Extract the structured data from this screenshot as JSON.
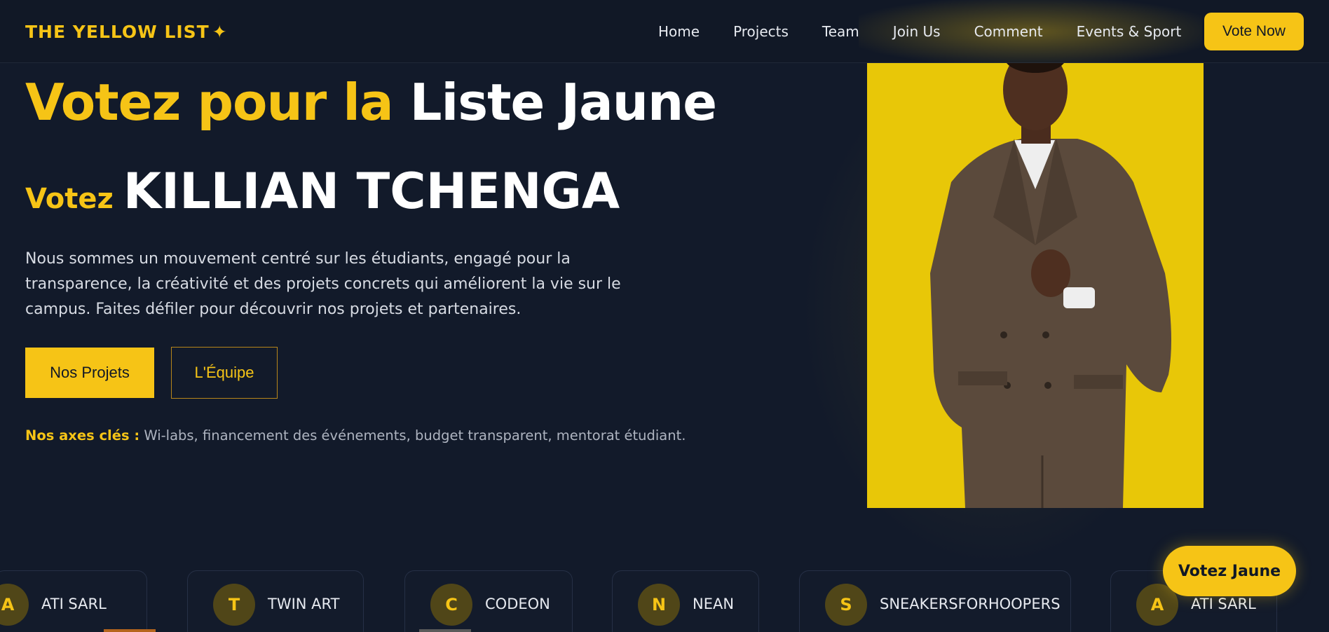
{
  "brand": {
    "name": "THE YELLOW LIST",
    "spark": "✦"
  },
  "nav": {
    "links": [
      "Home",
      "Projects",
      "Team",
      "Join Us",
      "Comment",
      "Events & Sport"
    ],
    "cta": "Vote Now"
  },
  "hero": {
    "title_part1": "Votez pour la",
    "title_part2": "Liste Jaune",
    "subtitle_prefix": "Votez",
    "subtitle_name": "KILLIAN TCHENGA",
    "description": "Nous sommes un mouvement centré sur les étudiants, engagé pour la transparence, la créativité et des projets concrets qui améliorent la vie sur le campus. Faites défiler pour découvrir nos projets et partenaires.",
    "primary_button": "Nos Projets",
    "secondary_button": "L'Équipe",
    "axes_label": "Nos axes clés :",
    "axes_text": "Wi-labs, financement des événements, budget transparent, mentorat étudiant."
  },
  "floating_button": "Votez Jaune",
  "partners": [
    {
      "initial": "A",
      "name": "ATI SARL"
    },
    {
      "initial": "T",
      "name": "TWIN ART"
    },
    {
      "initial": "C",
      "name": "CODEON"
    },
    {
      "initial": "N",
      "name": "NEAN"
    },
    {
      "initial": "S",
      "name": "SNEAKERSFORHOOPERS"
    },
    {
      "initial": "A",
      "name": "ATI SARL"
    }
  ],
  "colors": {
    "accent": "#f6c416",
    "background": "#121a2a",
    "nav_background": "#111826",
    "photo_background": "#e8c708"
  }
}
